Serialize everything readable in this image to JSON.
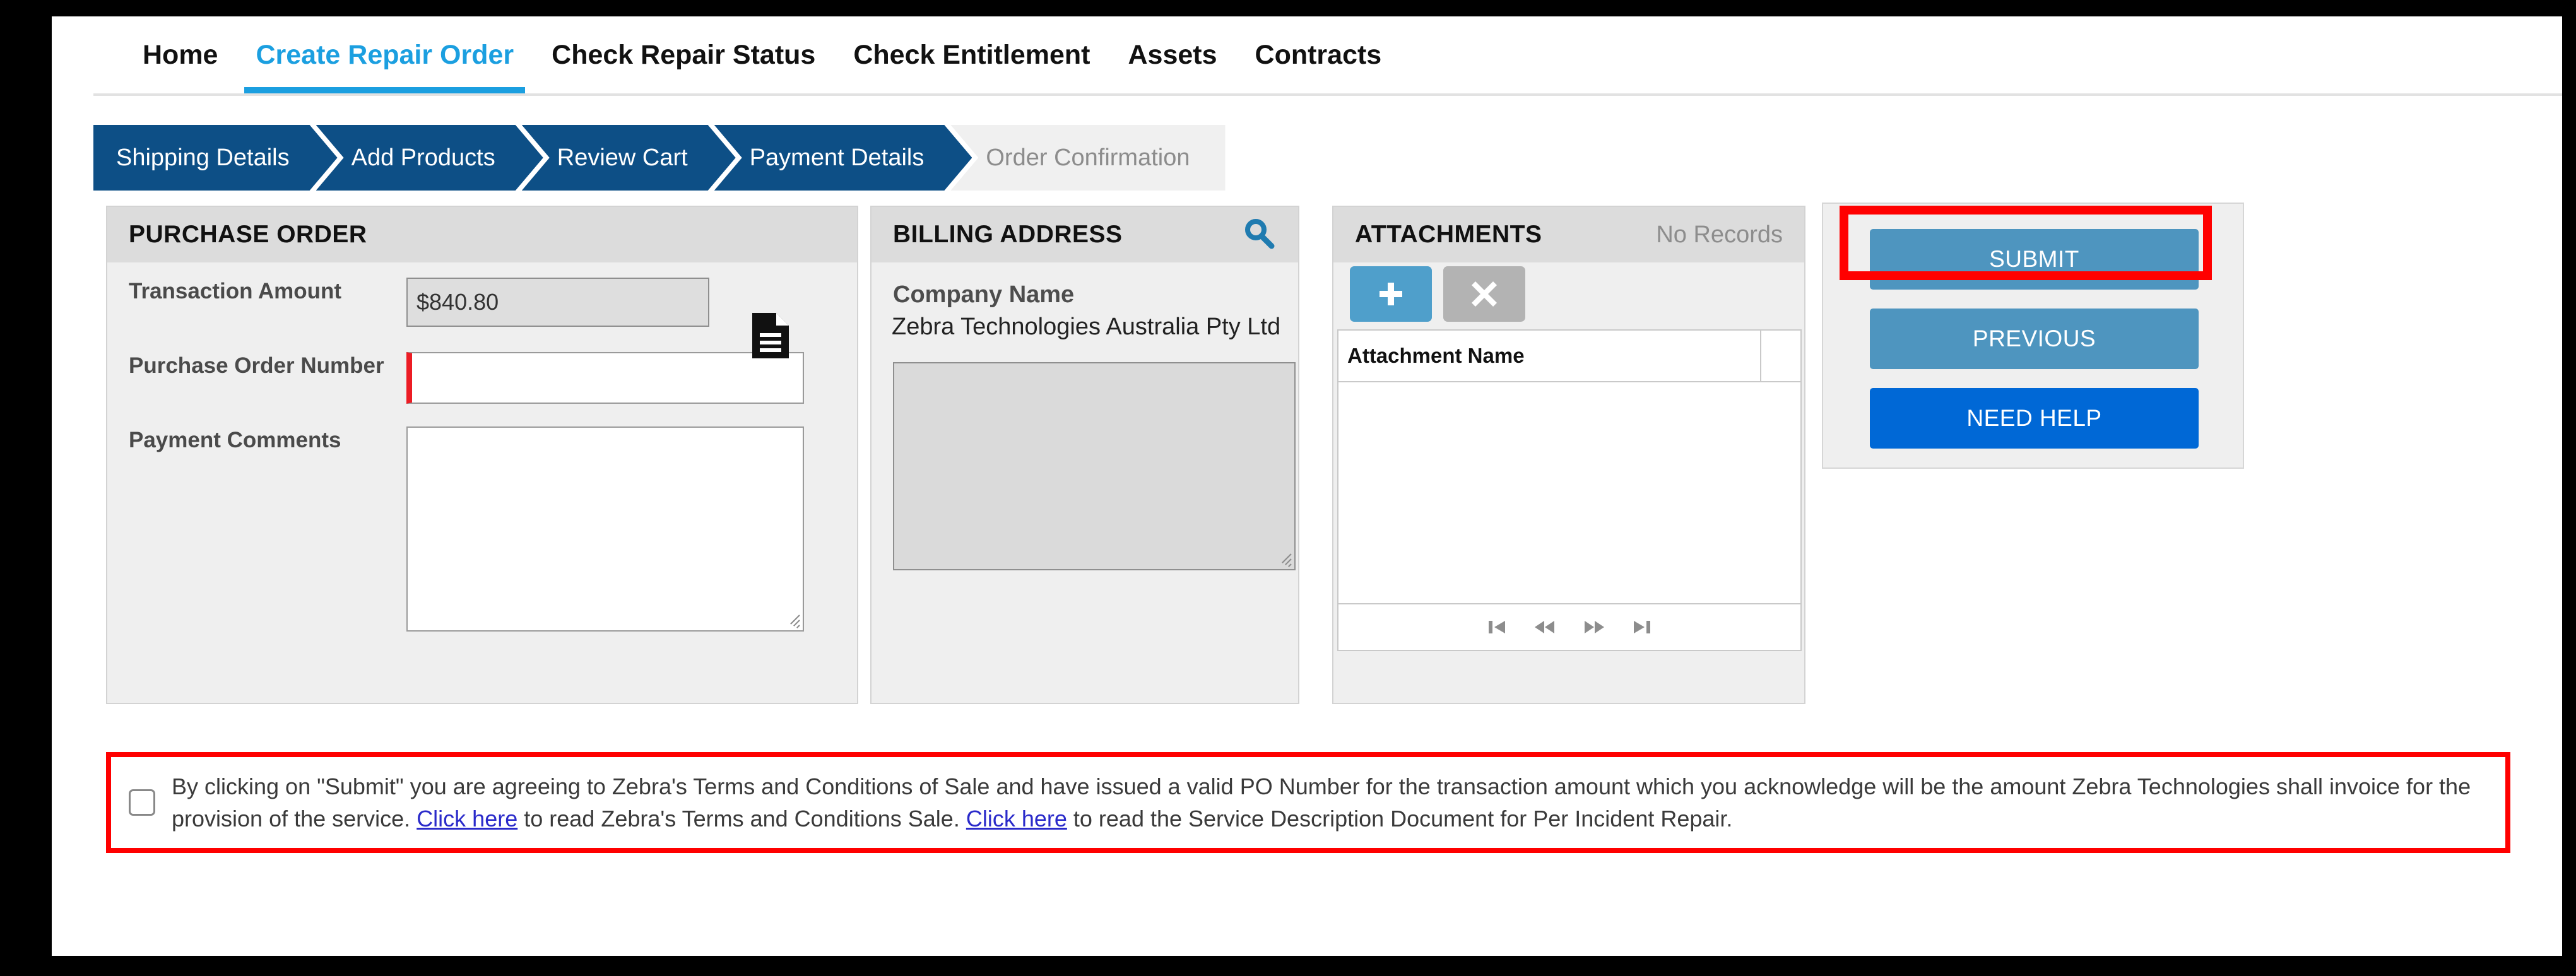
{
  "nav": {
    "tabs": [
      {
        "label": "Home",
        "active": false
      },
      {
        "label": "Create Repair Order",
        "active": true
      },
      {
        "label": "Check Repair Status",
        "active": false
      },
      {
        "label": "Check Entitlement",
        "active": false
      },
      {
        "label": "Assets",
        "active": false
      },
      {
        "label": "Contracts",
        "active": false
      }
    ]
  },
  "stepper": {
    "steps": [
      {
        "label": "Shipping Details",
        "state": "complete"
      },
      {
        "label": "Add Products",
        "state": "complete"
      },
      {
        "label": "Review Cart",
        "state": "complete"
      },
      {
        "label": "Payment Details",
        "state": "current"
      },
      {
        "label": "Order Confirmation",
        "state": "inactive"
      }
    ]
  },
  "purchase_order": {
    "title": "PURCHASE ORDER",
    "transaction_amount_label": "Transaction Amount",
    "transaction_amount_value": "$840.80",
    "po_number_label": "Purchase Order Number",
    "po_number_value": "",
    "po_number_placeholder": "",
    "payment_comments_label": "Payment Comments",
    "payment_comments_value": "",
    "document_icon": "document-icon",
    "required_marker_color": "#ec1c24"
  },
  "billing_address": {
    "title": "BILLING ADDRESS",
    "search_icon": "search-icon",
    "company_name_label": "Company Name",
    "company_name_value": "Zebra Technologies Australia Pty Ltd",
    "address_value": ""
  },
  "attachments": {
    "title": "ATTACHMENTS",
    "status": "No Records",
    "add_icon": "plus-icon",
    "delete_icon": "close-icon",
    "columns": [
      "Attachment Name"
    ],
    "rows": [],
    "pager": [
      {
        "name": "first-page-icon"
      },
      {
        "name": "previous-page-icon"
      },
      {
        "name": "next-page-icon"
      },
      {
        "name": "last-page-icon"
      }
    ]
  },
  "actions": {
    "submit_label": "SUBMIT",
    "previous_label": "PREVIOUS",
    "need_help_label": "NEED HELP",
    "highlight_color": "#ff0000",
    "muted_button_color": "#4e95bf",
    "vivid_button_color": "#0068d6"
  },
  "terms": {
    "checked": false,
    "part1": "By clicking on \"Submit\" you are agreeing to Zebra's Terms and Conditions of Sale and have issued a valid PO Number for the transaction amount which you acknowledge will be the amount Zebra Technologies shall invoice for the provision of the service. ",
    "link1": "Click here",
    "part2": " to read Zebra's Terms and Conditions Sale. ",
    "link2": "Click here",
    "part3": " to read the Service Description Document for Per Incident Repair."
  }
}
